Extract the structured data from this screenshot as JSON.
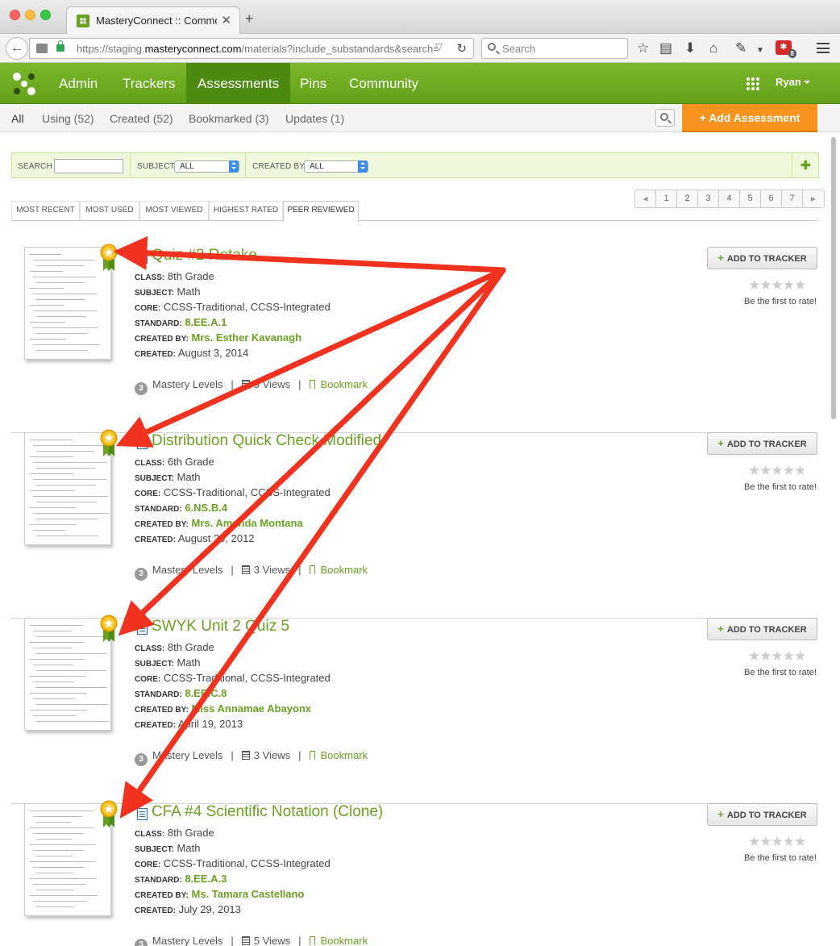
{
  "browser": {
    "tab_title": "MasteryConnect :: Commo...",
    "url_prefix": "https://staging.",
    "url_domain": "masteryconnect.com",
    "url_suffix": "/materials?include_substandards&search=&su",
    "search_placeholder": "Search",
    "ext_badge_count": "8"
  },
  "nav": {
    "items": [
      "Admin",
      "Trackers",
      "Assessments",
      "Pins",
      "Community"
    ],
    "active": "Assessments",
    "user": "Ryan"
  },
  "subnav": {
    "items": [
      "All",
      "Using (52)",
      "Created (52)",
      "Bookmarked (3)",
      "Updates (1)"
    ],
    "add_button": "+ Add Assessment"
  },
  "filters": {
    "search_label": "SEARCH",
    "subject_label": "SUBJECT",
    "subject_value": "ALL",
    "created_by_label": "CREATED BY",
    "created_by_value": "ALL",
    "add_icon": "plus-icon"
  },
  "sort_tabs": [
    "MOST RECENT",
    "MOST USED",
    "MOST VIEWED",
    "HIGHEST RATED",
    "PEER REVIEWED"
  ],
  "active_sort_tab": "PEER REVIEWED",
  "pager": {
    "prev": "◀",
    "pages": [
      "1",
      "2",
      "3",
      "4",
      "5",
      "6",
      "7"
    ],
    "next": "▶"
  },
  "labels": {
    "class": "CLASS:",
    "subject": "SUBJECT:",
    "core": "CORE:",
    "standard": "STANDARD:",
    "created_by": "CREATED BY:",
    "created": "CREATED:",
    "mastery_levels": "Mastery Levels",
    "bookmark": "Bookmark",
    "add_to_tracker": "ADD TO TRACKER",
    "rate_prompt": "Be the first to rate!",
    "stars": "★★★★★"
  },
  "assessments": [
    {
      "title": "Quiz #2 Retake",
      "class": "8th Grade",
      "subject": "Math",
      "core": "CCSS-Traditional, CCSS-Integrated",
      "standard": "8.EE.A.1",
      "created_by": "Mrs. Esther Kavanagh",
      "created": "August 3, 2014",
      "mastery_levels": "3",
      "views": "9 Views"
    },
    {
      "title": "Distribution Quick Check Modified",
      "class": "6th Grade",
      "subject": "Math",
      "core": "CCSS-Traditional, CCSS-Integrated",
      "standard": "6.NS.B.4",
      "created_by": "Mrs. Amanda Montana",
      "created": "August 29, 2012",
      "mastery_levels": "3",
      "views": "3 Views"
    },
    {
      "title": "SWYK Unit 2 Quiz 5",
      "class": "8th Grade",
      "subject": "Math",
      "core": "CCSS-Traditional, CCSS-Integrated",
      "standard": "8.EE.C.8",
      "created_by": "Miss Annamae Abayonx",
      "created": "April 19, 2013",
      "mastery_levels": "3",
      "views": "3 Views"
    },
    {
      "title": "CFA #4 Scientific Notation (Clone)",
      "class": "8th Grade",
      "subject": "Math",
      "core": "CCSS-Traditional, CCSS-Integrated",
      "standard": "8.EE.A.3",
      "created_by": "Ms. Tamara Castellano",
      "created": "July 29, 2013",
      "mastery_levels": "3",
      "views": "5 Views"
    }
  ],
  "colors": {
    "brand_green": "#6aa121",
    "nav_green": "#63a01a",
    "orange": "#f7941d",
    "annotation_red": "#f0321e"
  }
}
